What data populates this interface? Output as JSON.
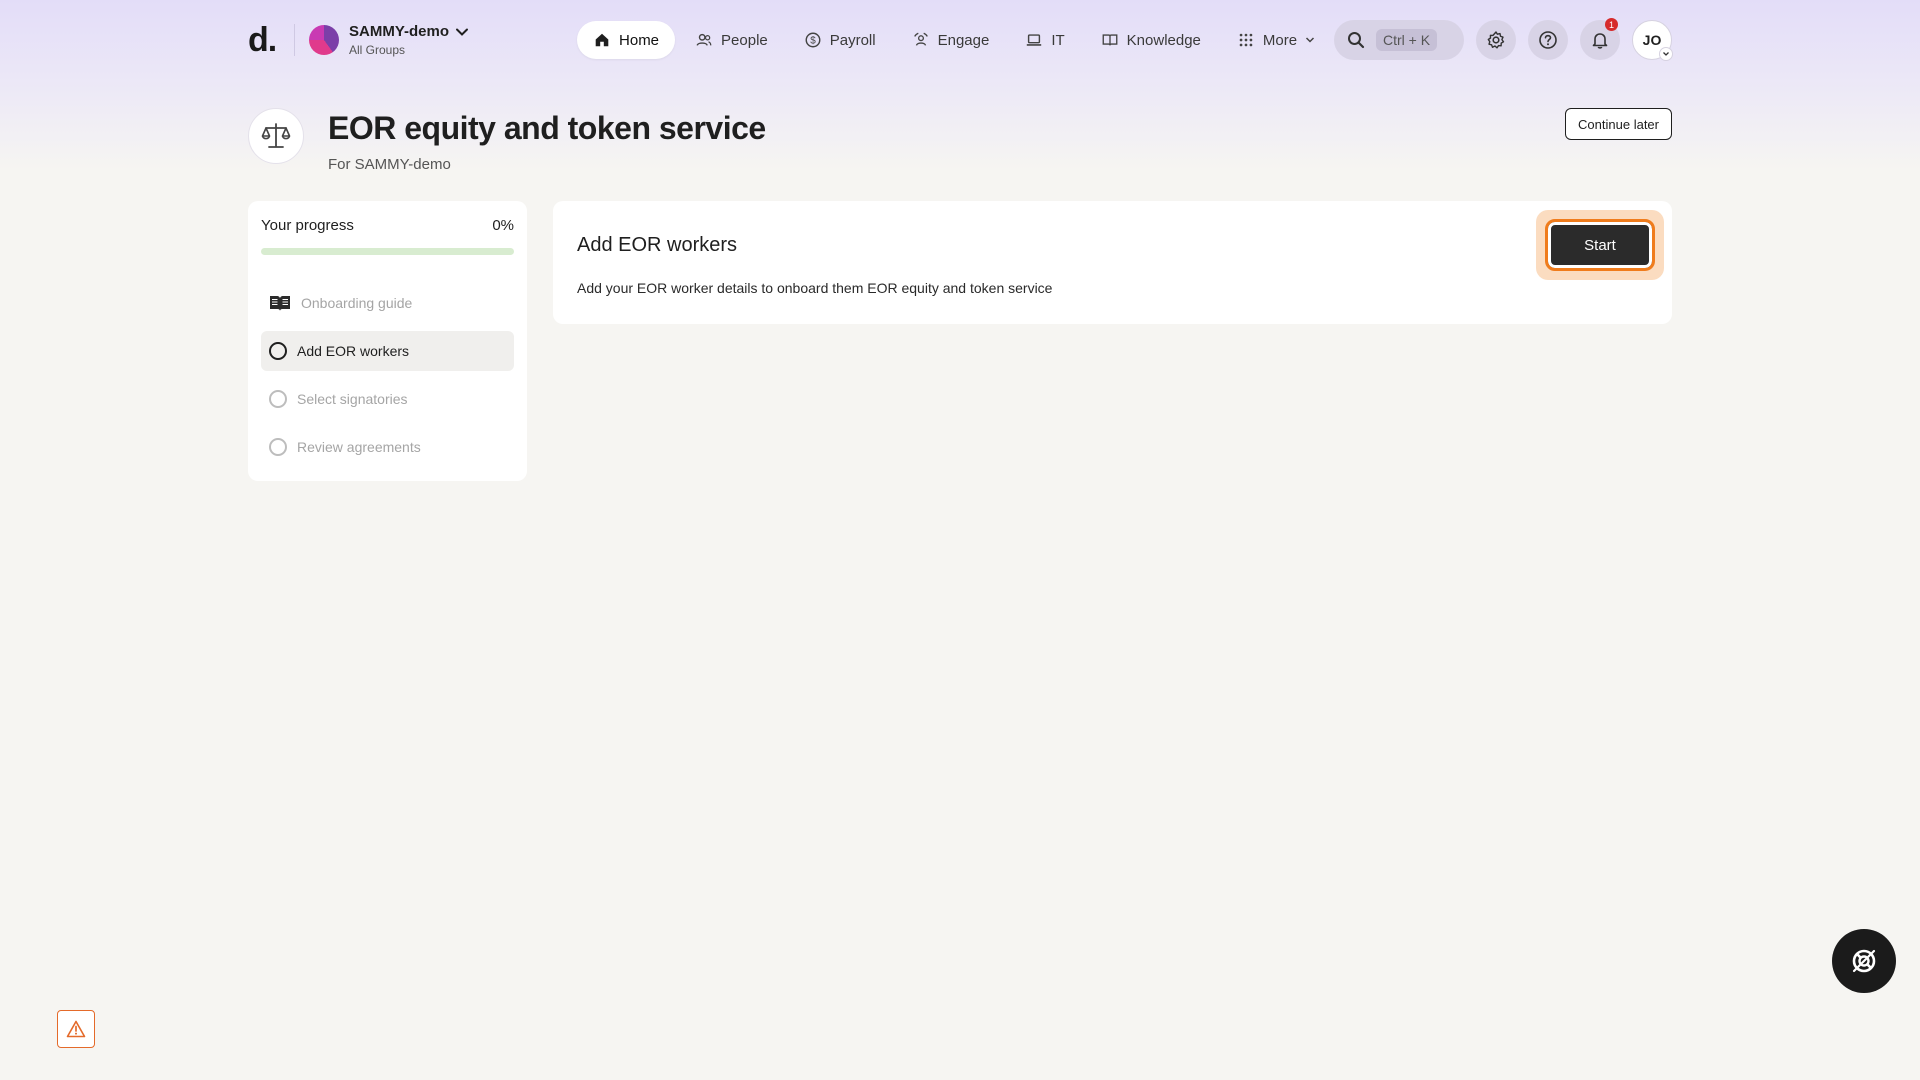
{
  "brand": {
    "logo_text": "d."
  },
  "org": {
    "name": "SAMMY-demo",
    "subtitle": "All Groups"
  },
  "nav": {
    "items": [
      {
        "label": "Home",
        "icon": "home-icon",
        "active": true
      },
      {
        "label": "People",
        "icon": "people-icon",
        "active": false
      },
      {
        "label": "Payroll",
        "icon": "payroll-icon",
        "active": false
      },
      {
        "label": "Engage",
        "icon": "engage-icon",
        "active": false
      },
      {
        "label": "IT",
        "icon": "laptop-icon",
        "active": false
      },
      {
        "label": "Knowledge",
        "icon": "book-icon",
        "active": false
      },
      {
        "label": "More",
        "icon": "grid-icon",
        "active": false
      }
    ]
  },
  "search": {
    "shortcut": "Ctrl + K"
  },
  "notifications": {
    "count": "1"
  },
  "user": {
    "initials": "JO"
  },
  "page": {
    "title": "EOR equity and token service",
    "subtitle": "For SAMMY-demo",
    "continue_label": "Continue later"
  },
  "progress": {
    "label": "Your progress",
    "percent_text": "0%",
    "fraction": 0,
    "steps": [
      {
        "label": "Onboarding guide",
        "type": "guide",
        "active": false
      },
      {
        "label": "Add EOR workers",
        "type": "step",
        "active": true
      },
      {
        "label": "Select signatories",
        "type": "step",
        "active": false
      },
      {
        "label": "Review agreements",
        "type": "step",
        "active": false
      }
    ]
  },
  "task": {
    "title": "Add EOR workers",
    "description": "Add your EOR worker details to onboard them EOR equity and token service",
    "start_label": "Start"
  },
  "colors": {
    "accent_orange": "#f07c1c",
    "progress_green": "#5cb85c",
    "notification_red": "#d62b2b",
    "header_lavender": "#e3ddf8"
  }
}
